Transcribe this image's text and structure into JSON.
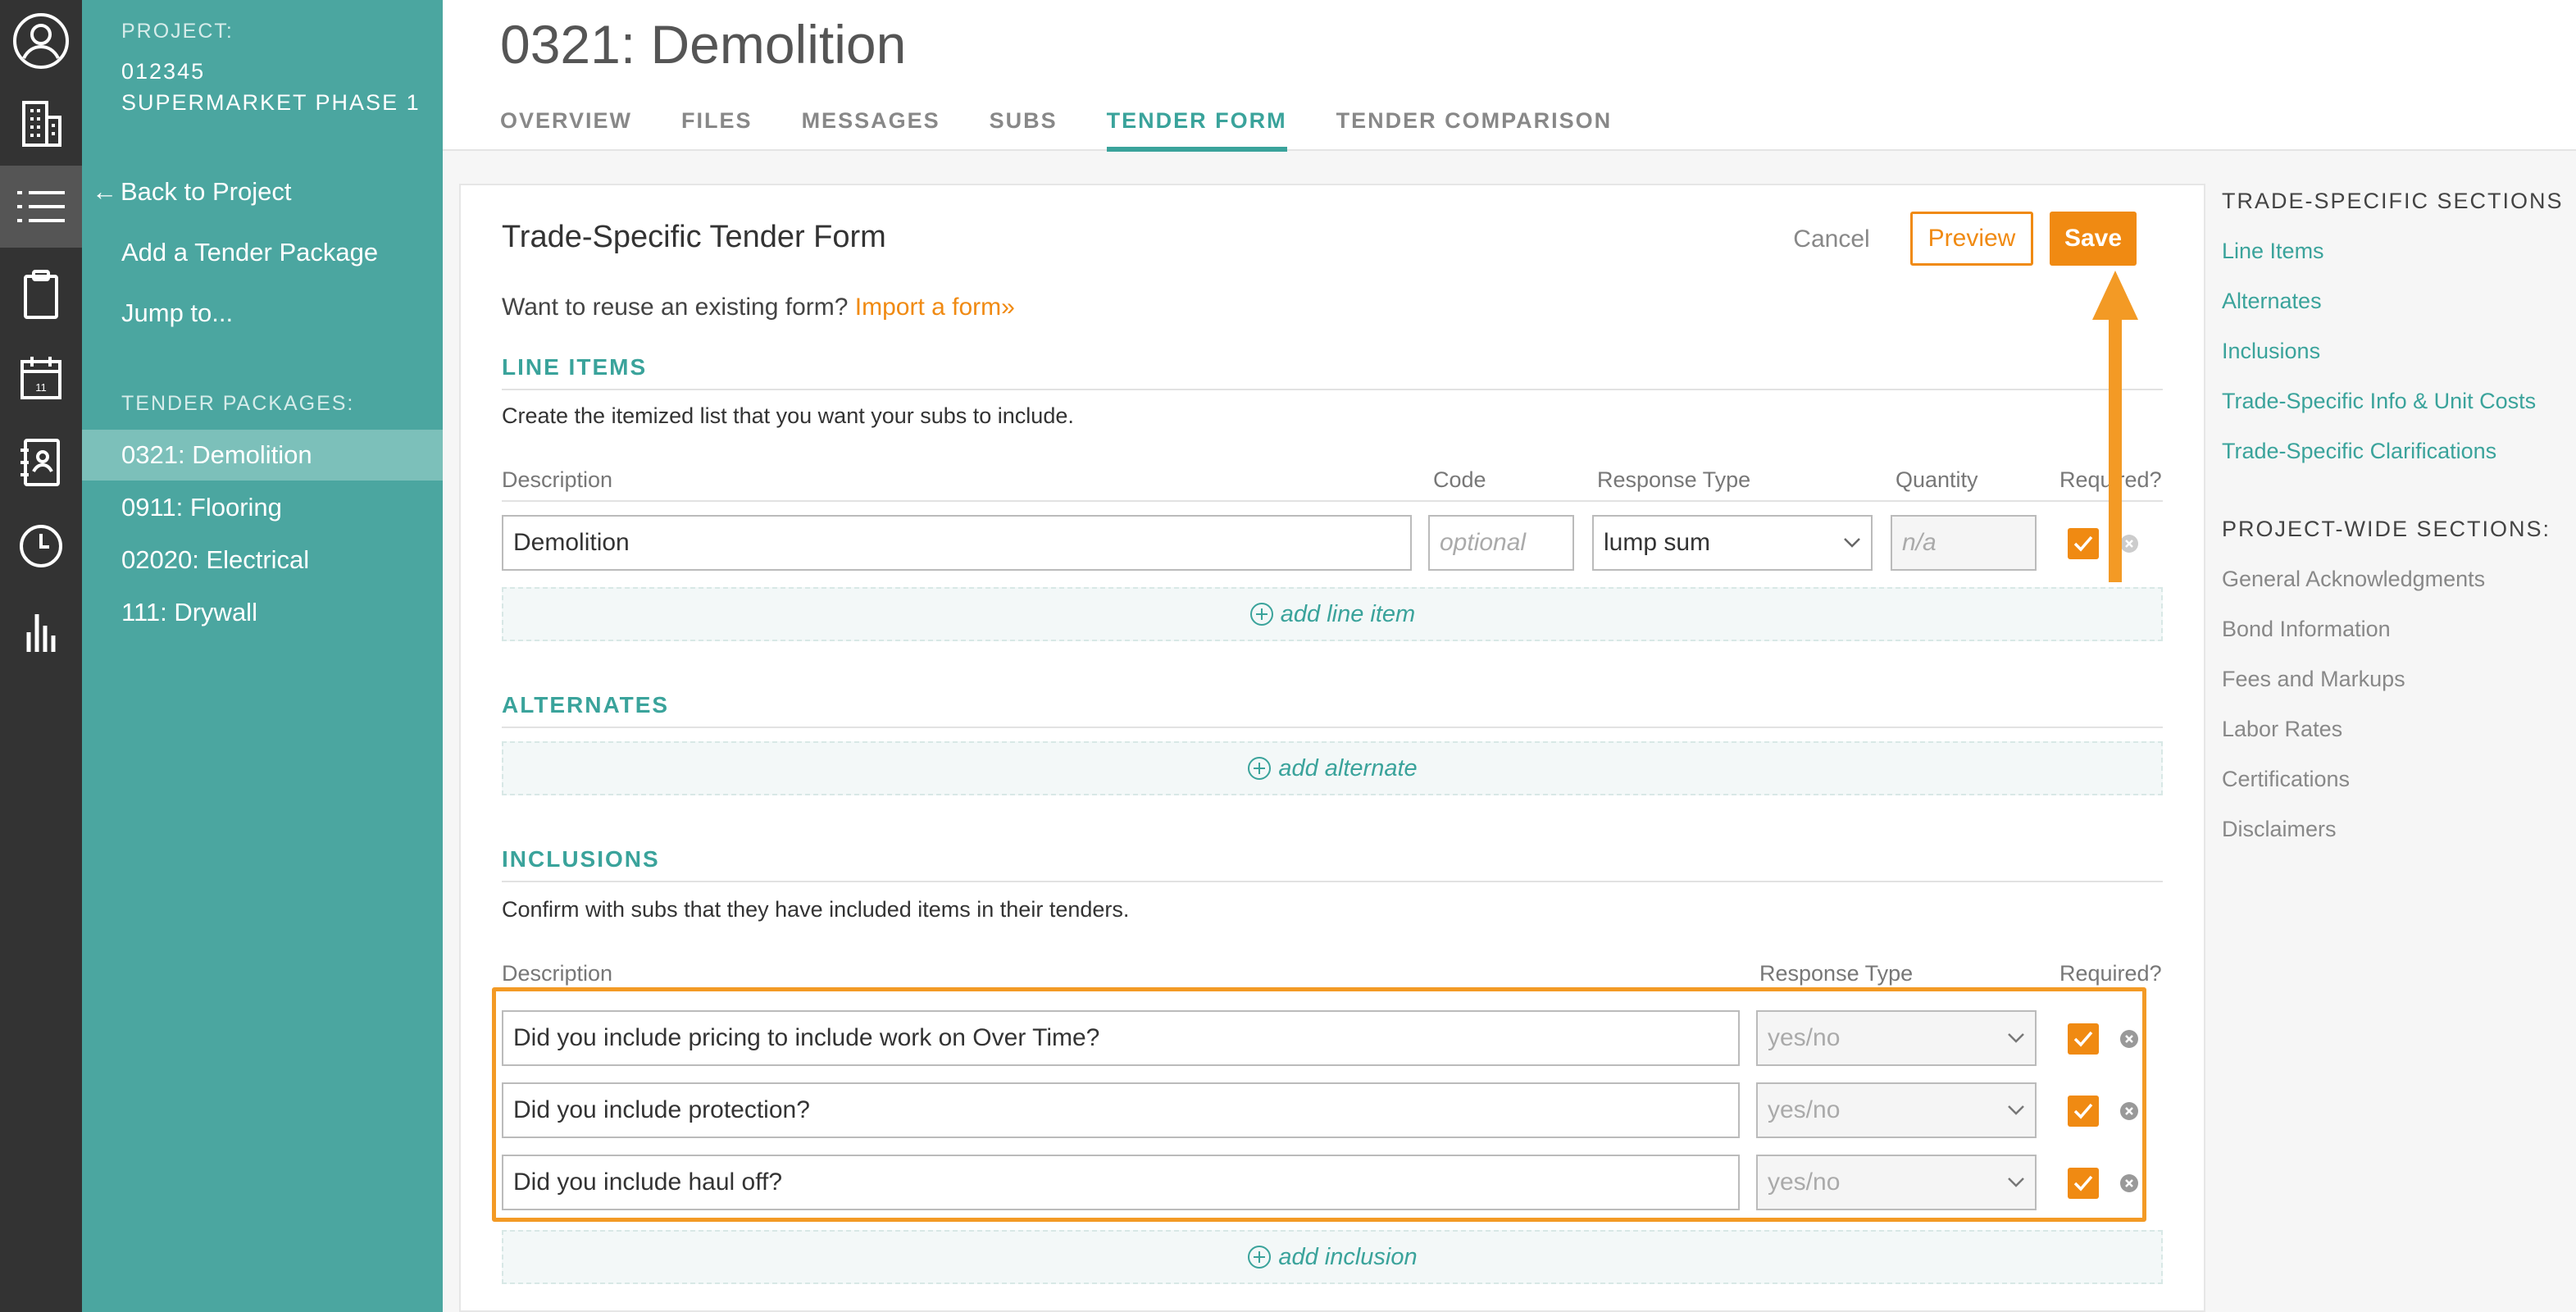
{
  "rail": {
    "items": [
      {
        "icon": "user-avatar-icon"
      },
      {
        "icon": "building-icon"
      },
      {
        "icon": "list-icon"
      },
      {
        "icon": "clipboard-icon"
      },
      {
        "icon": "calendar-icon",
        "day": "11"
      },
      {
        "icon": "address-book-icon"
      },
      {
        "icon": "clock-icon"
      },
      {
        "icon": "bar-chart-icon"
      }
    ]
  },
  "sidebar": {
    "project_label": "PROJECT:",
    "project_name": "012345\nSUPERMARKET PHASE 1",
    "back_link": "Back to Project",
    "back_arrow": "←",
    "add_package": "Add a Tender Package",
    "jump_to": "Jump to...",
    "packages_label": "TENDER PACKAGES:",
    "packages": [
      {
        "label": "0321: Demolition",
        "active": true
      },
      {
        "label": "0911: Flooring",
        "active": false
      },
      {
        "label": "02020: Electrical",
        "active": false
      },
      {
        "label": "111: Drywall",
        "active": false
      }
    ]
  },
  "header": {
    "title": "0321: Demolition",
    "tabs": [
      "OVERVIEW",
      "FILES",
      "MESSAGES",
      "SUBS",
      "TENDER FORM",
      "TENDER COMPARISON"
    ],
    "active_tab": "TENDER FORM"
  },
  "form": {
    "title": "Trade-Specific Tender Form",
    "cancel": "Cancel",
    "preview": "Preview",
    "save": "Save",
    "reuse_text": "Want to reuse an existing form?",
    "import_link": "Import a form»"
  },
  "line_items": {
    "heading": "LINE ITEMS",
    "description": "Create the itemized list that you want your subs to include.",
    "columns": {
      "description": "Description",
      "code": "Code",
      "response_type": "Response Type",
      "quantity": "Quantity",
      "required": "Required?"
    },
    "rows": [
      {
        "description": "Demolition",
        "code_placeholder": "optional",
        "response_type": "lump sum",
        "quantity_placeholder": "n/a",
        "required": true
      }
    ],
    "add_label": "add line item"
  },
  "alternates": {
    "heading": "ALTERNATES",
    "add_label": "add alternate"
  },
  "inclusions": {
    "heading": "INCLUSIONS",
    "description": "Confirm with subs that they have included items in their tenders.",
    "columns": {
      "description": "Description",
      "response_type": "Response Type",
      "required": "Required?"
    },
    "rows": [
      {
        "description": "Did you include pricing to include work on Over Time?",
        "response_type": "yes/no",
        "required": true
      },
      {
        "description": "Did you include protection?",
        "response_type": "yes/no",
        "required": true
      },
      {
        "description": "Did you include haul off?",
        "response_type": "yes/no",
        "required": true
      }
    ],
    "add_label": "add inclusion"
  },
  "toc": {
    "trade_heading": "TRADE-SPECIFIC SECTIONS",
    "trade_links": [
      "Line Items",
      "Alternates",
      "Inclusions",
      "Trade-Specific Info & Unit Costs",
      "Trade-Specific Clarifications"
    ],
    "project_heading": "PROJECT-WIDE SECTIONS:",
    "project_links": [
      "General Acknowledgments",
      "Bond Information",
      "Fees and Markups",
      "Labor Rates",
      "Certifications",
      "Disclaimers"
    ]
  },
  "colors": {
    "accent_teal": "#4ba6a0",
    "accent_orange": "#f08a12",
    "rail": "#333333"
  }
}
